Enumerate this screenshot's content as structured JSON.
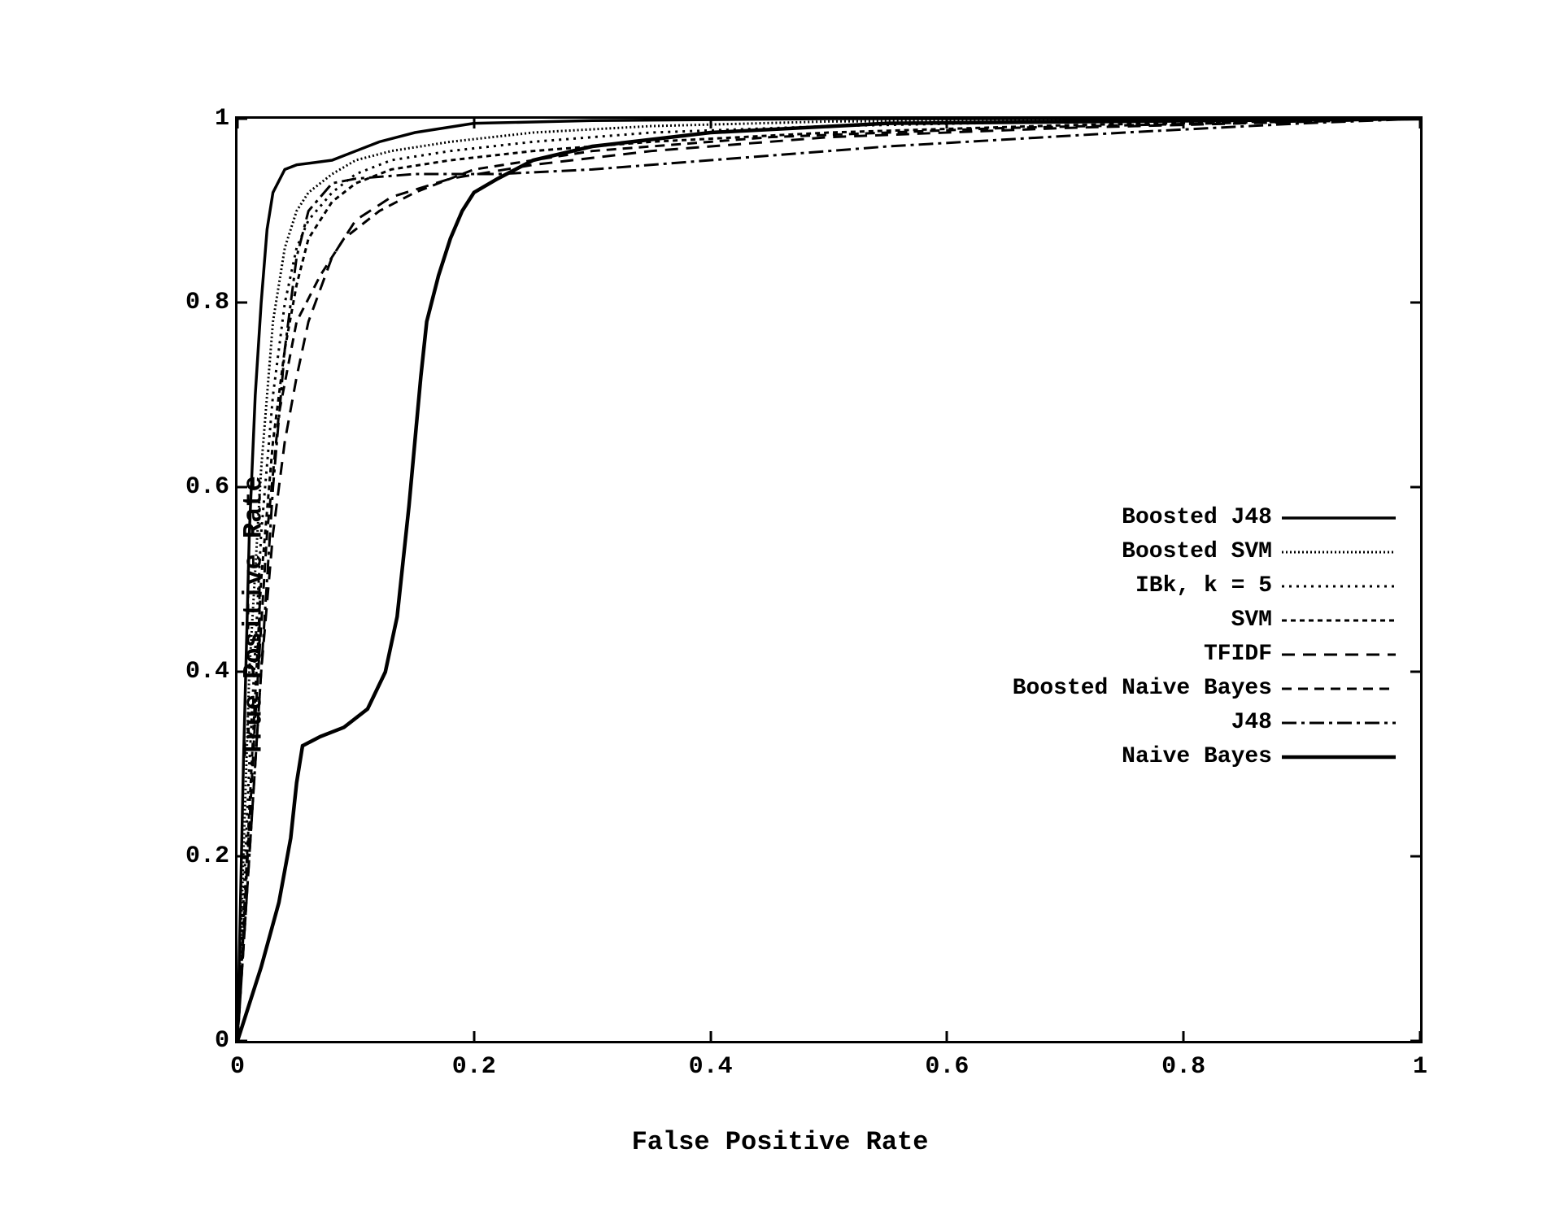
{
  "chart_data": {
    "type": "line",
    "title": "",
    "xlabel": "False Positive Rate",
    "ylabel": "True Positive Rate",
    "xlim": [
      0,
      1
    ],
    "ylim": [
      0,
      1
    ],
    "x_ticks": [
      0,
      0.2,
      0.4,
      0.6,
      0.8,
      1
    ],
    "y_ticks": [
      0,
      0.2,
      0.4,
      0.6,
      0.8,
      1
    ],
    "x_tick_labels": [
      "0",
      "0.2",
      "0.4",
      "0.6",
      "0.8",
      "1"
    ],
    "y_tick_labels": [
      "0",
      "0.2",
      "0.4",
      "0.6",
      "0.8",
      "1"
    ],
    "legend_position": "center-right",
    "series": [
      {
        "name": "Boosted J48",
        "style": "solid",
        "data": [
          [
            0.0,
            0.0
          ],
          [
            0.005,
            0.3
          ],
          [
            0.01,
            0.55
          ],
          [
            0.015,
            0.7
          ],
          [
            0.02,
            0.8
          ],
          [
            0.025,
            0.88
          ],
          [
            0.03,
            0.92
          ],
          [
            0.04,
            0.945
          ],
          [
            0.05,
            0.95
          ],
          [
            0.08,
            0.955
          ],
          [
            0.1,
            0.965
          ],
          [
            0.12,
            0.975
          ],
          [
            0.15,
            0.985
          ],
          [
            0.2,
            0.995
          ],
          [
            0.3,
            0.998
          ],
          [
            0.5,
            1.0
          ],
          [
            1.0,
            1.0
          ]
        ]
      },
      {
        "name": "Boosted SVM",
        "style": "dense-dot",
        "data": [
          [
            0.0,
            0.0
          ],
          [
            0.01,
            0.4
          ],
          [
            0.02,
            0.62
          ],
          [
            0.03,
            0.78
          ],
          [
            0.04,
            0.86
          ],
          [
            0.05,
            0.9
          ],
          [
            0.06,
            0.92
          ],
          [
            0.08,
            0.94
          ],
          [
            0.1,
            0.955
          ],
          [
            0.13,
            0.965
          ],
          [
            0.18,
            0.975
          ],
          [
            0.25,
            0.985
          ],
          [
            0.35,
            0.992
          ],
          [
            0.5,
            0.997
          ],
          [
            1.0,
            1.0
          ]
        ]
      },
      {
        "name": "IBk, k = 5",
        "style": "dotted",
        "data": [
          [
            0.0,
            0.0
          ],
          [
            0.01,
            0.3
          ],
          [
            0.02,
            0.55
          ],
          [
            0.03,
            0.7
          ],
          [
            0.04,
            0.8
          ],
          [
            0.05,
            0.86
          ],
          [
            0.06,
            0.89
          ],
          [
            0.08,
            0.92
          ],
          [
            0.1,
            0.94
          ],
          [
            0.13,
            0.955
          ],
          [
            0.18,
            0.965
          ],
          [
            0.25,
            0.975
          ],
          [
            0.35,
            0.985
          ],
          [
            0.5,
            0.992
          ],
          [
            0.7,
            0.997
          ],
          [
            1.0,
            1.0
          ]
        ]
      },
      {
        "name": "SVM",
        "style": "fine-dash",
        "data": [
          [
            0.0,
            0.0
          ],
          [
            0.01,
            0.25
          ],
          [
            0.02,
            0.5
          ],
          [
            0.03,
            0.65
          ],
          [
            0.04,
            0.75
          ],
          [
            0.05,
            0.82
          ],
          [
            0.06,
            0.87
          ],
          [
            0.08,
            0.91
          ],
          [
            0.1,
            0.93
          ],
          [
            0.13,
            0.945
          ],
          [
            0.18,
            0.955
          ],
          [
            0.25,
            0.965
          ],
          [
            0.35,
            0.975
          ],
          [
            0.5,
            0.985
          ],
          [
            0.7,
            0.993
          ],
          [
            1.0,
            1.0
          ]
        ]
      },
      {
        "name": "TFIDF",
        "style": "long-dash",
        "data": [
          [
            0.0,
            0.0
          ],
          [
            0.01,
            0.2
          ],
          [
            0.02,
            0.4
          ],
          [
            0.03,
            0.55
          ],
          [
            0.04,
            0.65
          ],
          [
            0.05,
            0.72
          ],
          [
            0.06,
            0.78
          ],
          [
            0.08,
            0.85
          ],
          [
            0.1,
            0.89
          ],
          [
            0.13,
            0.915
          ],
          [
            0.18,
            0.935
          ],
          [
            0.25,
            0.95
          ],
          [
            0.35,
            0.965
          ],
          [
            0.5,
            0.98
          ],
          [
            0.7,
            0.99
          ],
          [
            1.0,
            1.0
          ]
        ]
      },
      {
        "name": "Boosted Naive Bayes",
        "style": "medium-dash",
        "data": [
          [
            0.0,
            0.0
          ],
          [
            0.015,
            0.35
          ],
          [
            0.025,
            0.55
          ],
          [
            0.035,
            0.68
          ],
          [
            0.05,
            0.78
          ],
          [
            0.07,
            0.83
          ],
          [
            0.09,
            0.87
          ],
          [
            0.12,
            0.9
          ],
          [
            0.15,
            0.92
          ],
          [
            0.2,
            0.945
          ],
          [
            0.3,
            0.965
          ],
          [
            0.45,
            0.98
          ],
          [
            0.65,
            0.99
          ],
          [
            1.0,
            1.0
          ]
        ]
      },
      {
        "name": "J48",
        "style": "dash-dot",
        "data": [
          [
            0.0,
            0.0
          ],
          [
            0.02,
            0.4
          ],
          [
            0.03,
            0.6
          ],
          [
            0.04,
            0.75
          ],
          [
            0.05,
            0.85
          ],
          [
            0.06,
            0.9
          ],
          [
            0.08,
            0.93
          ],
          [
            0.1,
            0.935
          ],
          [
            0.15,
            0.94
          ],
          [
            0.22,
            0.94
          ],
          [
            0.3,
            0.945
          ],
          [
            0.4,
            0.955
          ],
          [
            0.55,
            0.97
          ],
          [
            0.75,
            0.985
          ],
          [
            0.9,
            0.995
          ],
          [
            1.0,
            1.0
          ]
        ]
      },
      {
        "name": "Naive Bayes",
        "style": "solid-thick",
        "data": [
          [
            0.0,
            0.0
          ],
          [
            0.02,
            0.08
          ],
          [
            0.035,
            0.15
          ],
          [
            0.045,
            0.22
          ],
          [
            0.05,
            0.28
          ],
          [
            0.055,
            0.32
          ],
          [
            0.07,
            0.33
          ],
          [
            0.09,
            0.34
          ],
          [
            0.11,
            0.36
          ],
          [
            0.125,
            0.4
          ],
          [
            0.135,
            0.46
          ],
          [
            0.14,
            0.52
          ],
          [
            0.145,
            0.58
          ],
          [
            0.15,
            0.65
          ],
          [
            0.155,
            0.72
          ],
          [
            0.16,
            0.78
          ],
          [
            0.17,
            0.83
          ],
          [
            0.18,
            0.87
          ],
          [
            0.19,
            0.9
          ],
          [
            0.2,
            0.92
          ],
          [
            0.22,
            0.935
          ],
          [
            0.25,
            0.955
          ],
          [
            0.3,
            0.97
          ],
          [
            0.4,
            0.985
          ],
          [
            0.55,
            0.995
          ],
          [
            1.0,
            1.0
          ]
        ]
      }
    ]
  },
  "legend": {
    "items": [
      "Boosted J48",
      "Boosted SVM",
      "IBk, k = 5",
      "SVM",
      "TFIDF",
      "Boosted Naive Bayes",
      "J48",
      "Naive Bayes"
    ]
  }
}
